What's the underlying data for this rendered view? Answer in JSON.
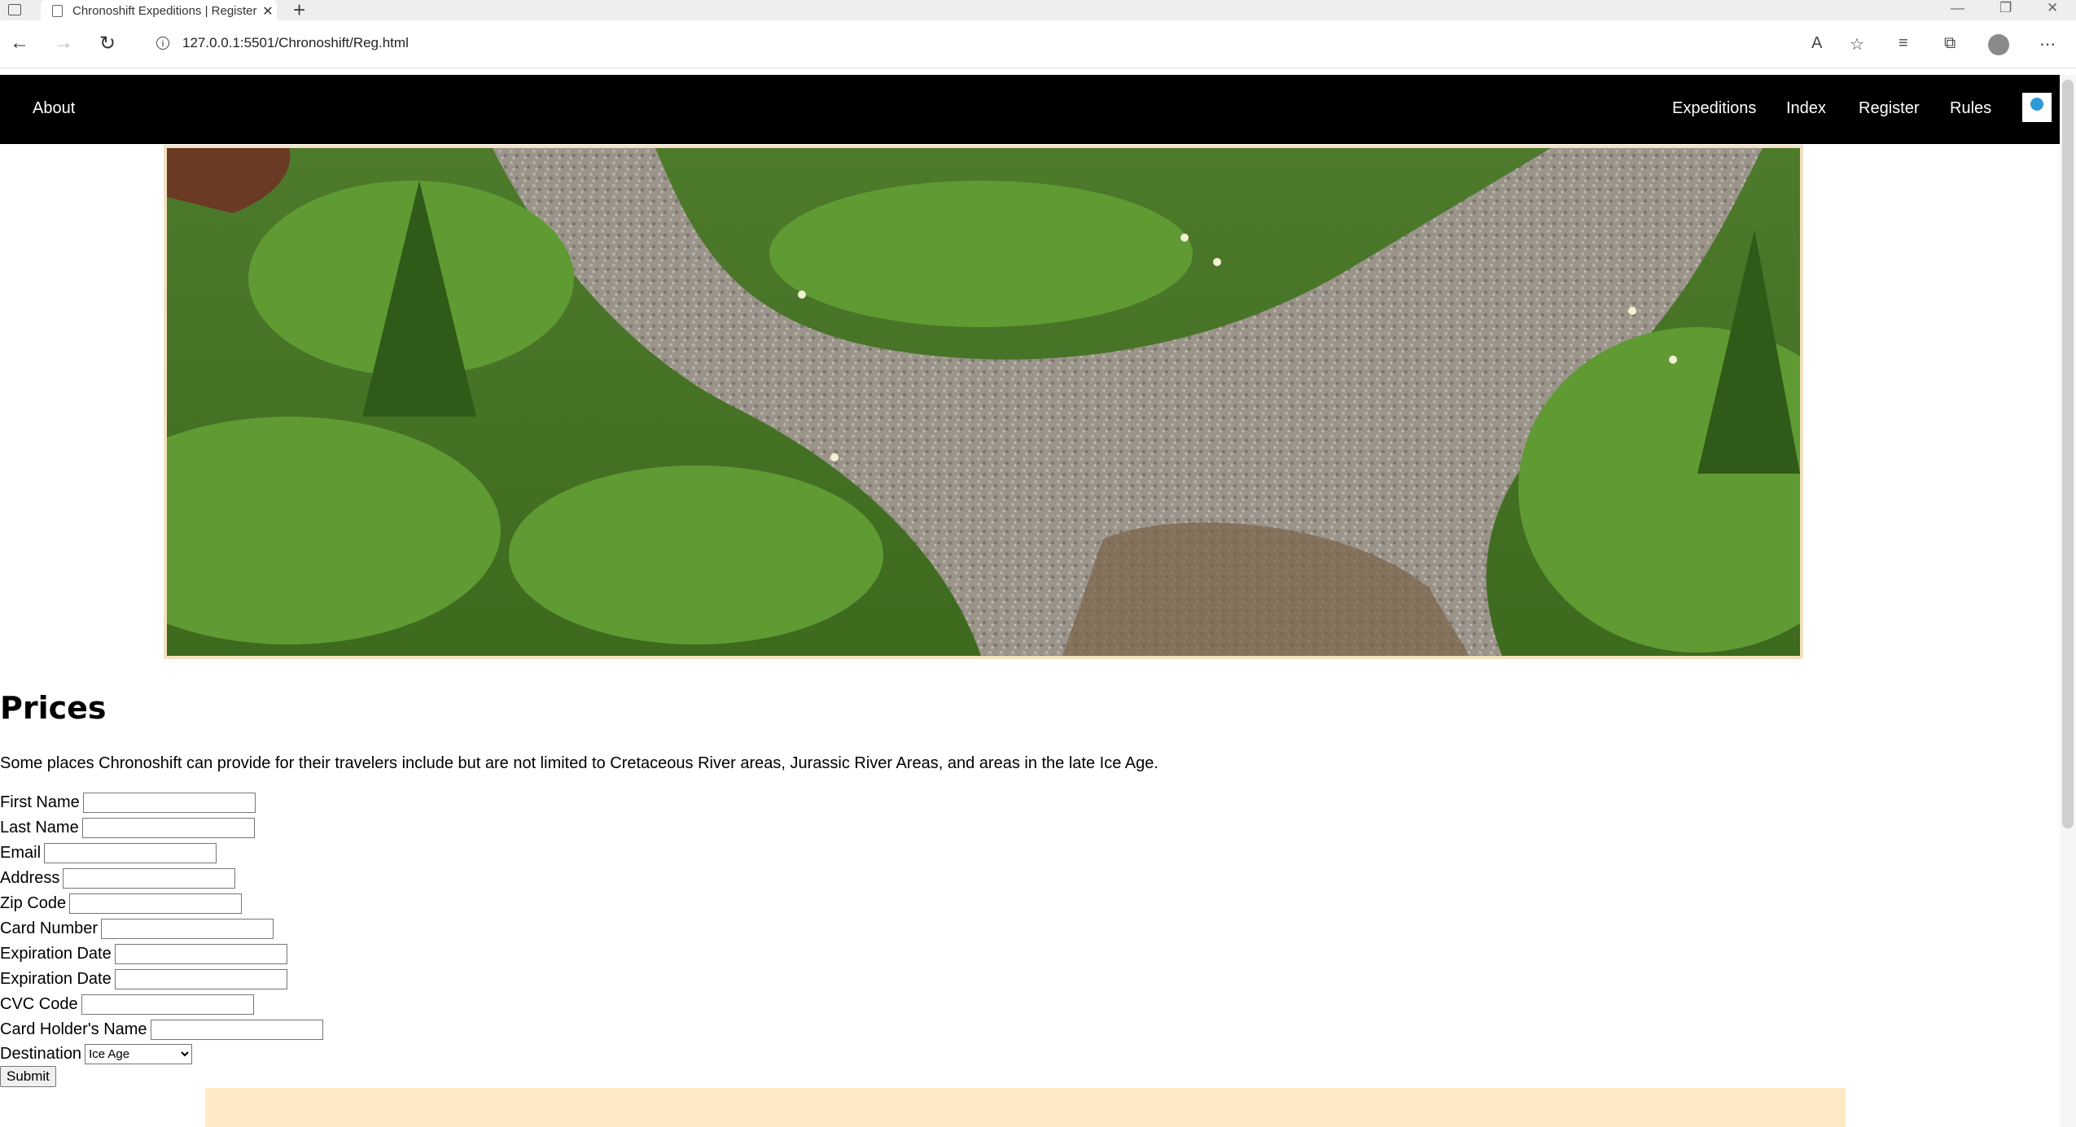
{
  "browser": {
    "tab_title": "Chronoshift Expeditions | Register",
    "url": "127.0.0.1:5501/Chronoshift/Reg.html",
    "icons": [
      "tab-menu-icon",
      "page-icon",
      "close-icon",
      "new-tab-icon",
      "back-icon",
      "forward-icon",
      "reload-icon",
      "info-icon",
      "read-aloud-icon",
      "add-favorite-icon",
      "favorites-icon",
      "collections-icon",
      "profile-icon",
      "more-icon",
      "minimize-icon",
      "restore-icon",
      "window-close-icon"
    ]
  },
  "nav": {
    "about": "About",
    "expeditions": "Expeditions",
    "index": "Index",
    "register": "Register",
    "rules": "Rules"
  },
  "main": {
    "heading": "Prices",
    "intro": "Some places Chronoshift can provide for their travelers include but are not limited to Cretaceous River areas, Jurassic River Areas, and areas in the late Ice Age."
  },
  "form": {
    "first_name": "First Name",
    "last_name": "Last Name",
    "email": "Email",
    "address": "Address",
    "zip": "Zip Code",
    "card_number": "Card Number",
    "expiration_1": "Expiration Date",
    "expiration_2": "Expiration Date",
    "cvc": "CVC Code",
    "card_holder": "Card Holder's Name",
    "destination": "Destination",
    "destination_selected": "Ice Age",
    "submit": "Submit"
  },
  "colors": {
    "nav_bg": "#000000",
    "hero_border": "#f4e2c0",
    "footer_strip": "#ffe8c6"
  }
}
